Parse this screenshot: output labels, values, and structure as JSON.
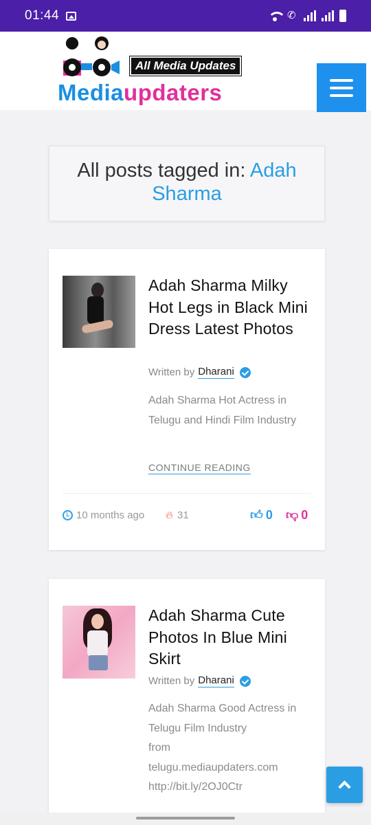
{
  "status_bar": {
    "time": "01:44"
  },
  "header": {
    "logo_tagline": "All Media Updates",
    "logo_word_1": "Media",
    "logo_word_2": "updaters"
  },
  "tag_box": {
    "prefix": "All posts tagged in:",
    "tag": "Adah Sharma"
  },
  "posts": [
    {
      "title": "Adah Sharma Milky Hot Legs in Black Mini Dress Latest Photos",
      "written_by": "Written by",
      "author": "Dharani",
      "excerpt": "Adah Sharma Hot Actress in Telugu and Hindi Film Industry",
      "continue_label": "CONTINUE READING",
      "time_ago": "10 months ago",
      "views": "31",
      "likes": "0",
      "dislikes": "0"
    },
    {
      "title": "Adah Sharma Cute Photos In Blue Mini Skirt",
      "written_by": "Written by",
      "author": "Dharani",
      "excerpt_lines": [
        "Adah Sharma Good Actress in",
        "Telugu Film Industry",
        "from",
        "telugu.mediaupdaters.com",
        "http://bit.ly/2OJ0Ctr"
      ]
    }
  ],
  "colors": {
    "status_bar": "#4b1fa8",
    "accent": "#2a9ee3",
    "dislike": "#e0309c"
  }
}
